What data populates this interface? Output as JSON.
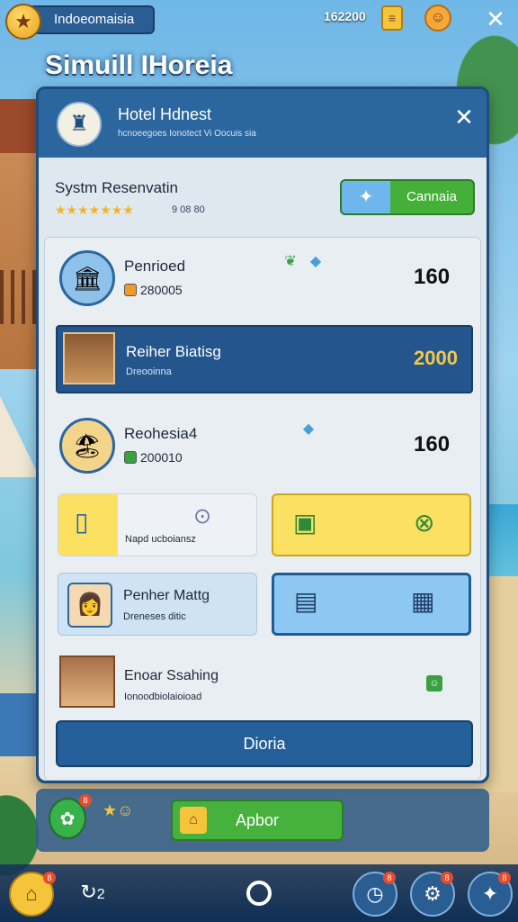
{
  "topbar": {
    "region": "Indoeomaisia",
    "coins": "162200"
  },
  "app_title": "Simuill IHoreia",
  "dialog": {
    "hotel_name": "Hotel Hdnest",
    "hotel_subtitle": "hcnoeegoes Ionotect Vi Oocuis sia",
    "reservation_title": "Systm Resenvatin",
    "rating_stars": "★★★★★★★",
    "rating_count": "9 08 80",
    "cannala_label": "Cannaia",
    "items": [
      {
        "title": "Penrioed",
        "sub": "280005",
        "price": "160"
      },
      {
        "title": "Reiher Biatisg",
        "sub": "Dreooinna",
        "price": "2000"
      },
      {
        "title": "Reohesia4",
        "sub": "200010",
        "price": "160"
      }
    ],
    "amenity_label": "Napd ucboiansz",
    "person_row": {
      "title": "Penher Mattg",
      "sub": "Dreneses ditic"
    },
    "estate_row": {
      "title": "Enoar Ssahing",
      "sub": "Ionoodbiolaioioad"
    },
    "bottom_button": "Dioria"
  },
  "lower": {
    "badge_count": "8",
    "apbor_label": "Apbor"
  },
  "nav": {
    "home_badge": "8",
    "clock_badge": "8",
    "settings_badge": "8",
    "star_badge": "8",
    "page_label": "2"
  },
  "colors": {
    "dialog_blue": "#2e6aa3",
    "accent_green": "#44b03a",
    "accent_yellow": "#fbe062",
    "price_gold": "#f2c74a"
  }
}
